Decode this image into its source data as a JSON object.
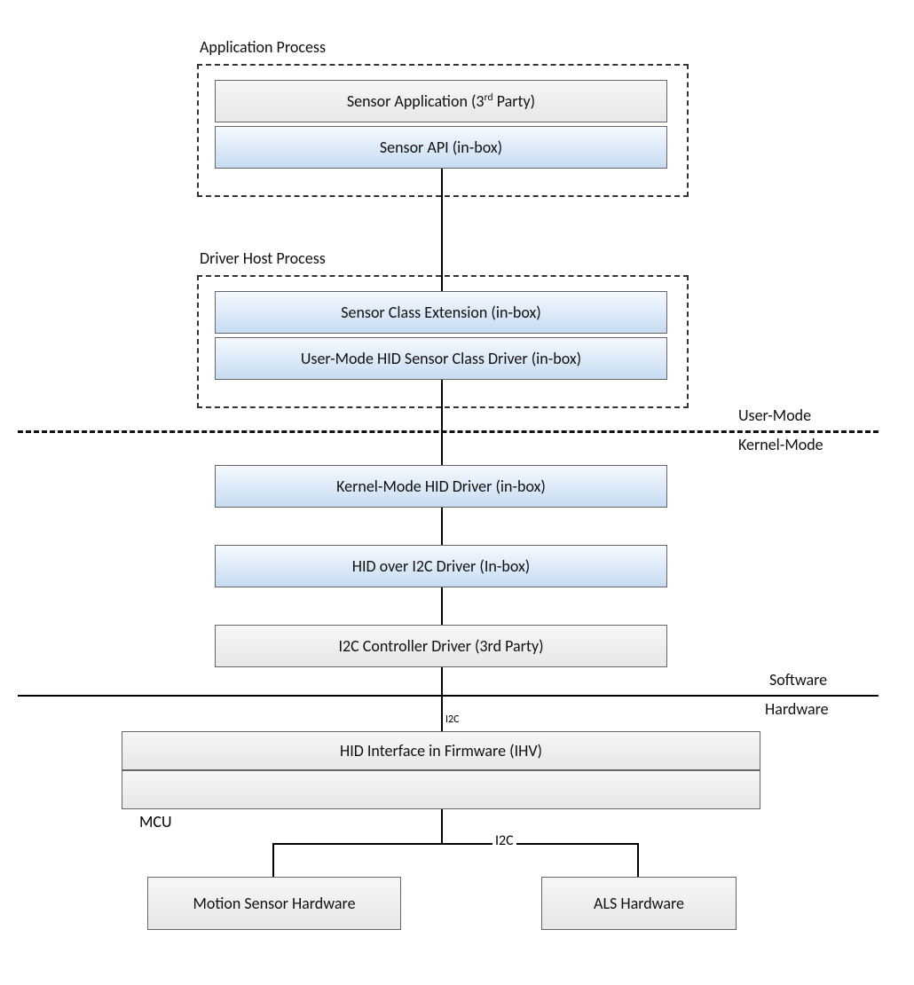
{
  "diagram": {
    "groups": [
      {
        "id": "application-process",
        "label": "Application Process"
      },
      {
        "id": "driver-host-process",
        "label": "Driver Host Process"
      }
    ],
    "boxes": [
      {
        "id": "sensor-application",
        "label_pre": "Sensor Application (3",
        "sup": "rd",
        "label_post": " Party)",
        "style": "gray"
      },
      {
        "id": "sensor-api",
        "label": "Sensor API (in-box)",
        "style": "blue"
      },
      {
        "id": "sensor-class-extension",
        "label": "Sensor Class Extension (in-box)",
        "style": "blue"
      },
      {
        "id": "user-mode-hid-sensor-class-driver",
        "label": "User-Mode HID Sensor Class Driver (in-box)",
        "style": "blue"
      },
      {
        "id": "kernel-mode-hid-driver",
        "label": "Kernel-Mode HID Driver (in-box)",
        "style": "blue"
      },
      {
        "id": "hid-over-i2c-driver",
        "label": "HID over I2C Driver (In-box)",
        "style": "blue"
      },
      {
        "id": "i2c-controller-driver",
        "label": "I2C Controller Driver (3rd Party)",
        "style": "gray"
      },
      {
        "id": "hid-firmware",
        "label": "HID Interface in Firmware (IHV)",
        "style": "gray"
      },
      {
        "id": "mcu",
        "label": "MCU",
        "style": "gray"
      },
      {
        "id": "motion-sensor-hw",
        "label": "Motion Sensor Hardware",
        "style": "gray"
      },
      {
        "id": "als-hw",
        "label": "ALS Hardware",
        "style": "gray"
      }
    ],
    "dividers": [
      {
        "id": "user-kernel",
        "top_label": "User-Mode",
        "bottom_label": "Kernel-Mode",
        "style": "dashed"
      },
      {
        "id": "software-hardware",
        "top_label": "Software",
        "bottom_label": "Hardware",
        "style": "solid"
      }
    ],
    "bus_labels": [
      "I2C",
      "I2C"
    ]
  }
}
